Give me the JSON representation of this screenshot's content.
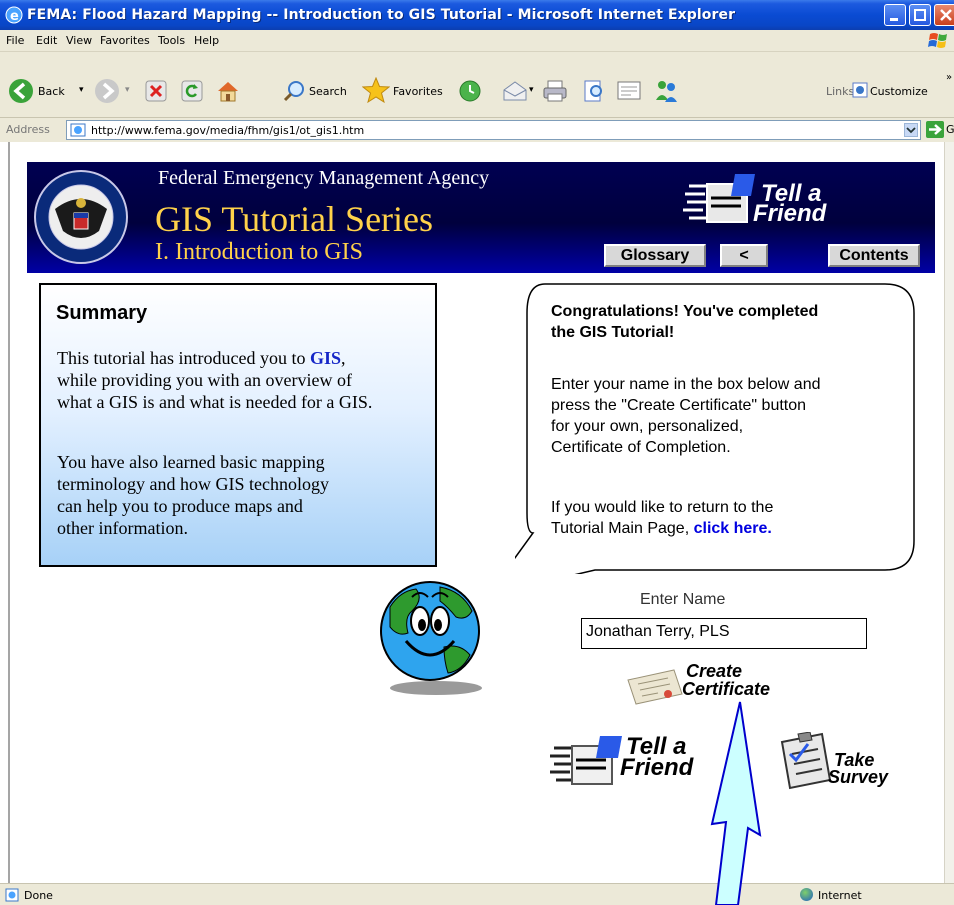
{
  "window": {
    "title": "FEMA: Flood Hazard Mapping -- Introduction to GIS Tutorial - Microsoft Internet Explorer"
  },
  "menubar": {
    "items": [
      "File",
      "Edit",
      "View",
      "Favorites",
      "Tools",
      "Help"
    ]
  },
  "toolbar": {
    "back_label": "Back",
    "search_label": "Search",
    "favorites_label": "Favorites",
    "links_label": "Links",
    "customize_label": "Customize"
  },
  "address": {
    "label": "Address",
    "url": "http://www.fema.gov/media/fhm/gis1/ot_gis1.htm",
    "go_label": "Go"
  },
  "banner": {
    "agency": "Federal Emergency Management Agency",
    "series": "GIS Tutorial Series",
    "chapter": "I. Introduction to GIS",
    "tell_a_friend_line1": "Tell a",
    "tell_a_friend_line2": "Friend",
    "glossary_label": "Glossary",
    "back_label": "<",
    "contents_label": "Contents"
  },
  "summary": {
    "heading": "Summary",
    "para1_pre": "This tutorial has introduced you to ",
    "para1_link": "GIS",
    "para1_post": ",",
    "para1_line2": "while providing you with an overview of",
    "para1_line3": "what a GIS is and what is needed for a GIS.",
    "para2_line1": "You have also learned basic mapping",
    "para2_line2": "terminology and how GIS technology",
    "para2_line3": "can help you to produce maps and",
    "para2_line4": "other information."
  },
  "bubble": {
    "congrats_line1": "Congratulations! You've completed",
    "congrats_line2": "the GIS Tutorial!",
    "instr_line1": "Enter your name in the box below and",
    "instr_line2": "press the \"Create Certificate\" button",
    "instr_line3": "for your own, personalized,",
    "instr_line4": "Certificate of Completion.",
    "return_line1": "If you would like to return to the",
    "return_line2": "Tutorial Main Page, ",
    "return_link": "click here."
  },
  "certificate": {
    "enter_name_label": "Enter Name",
    "name_value": "Jonathan Terry, PLS",
    "create_line1": "Create",
    "create_line2": "Certificate"
  },
  "footer_links": {
    "tell_line1": "Tell a",
    "tell_line2": "Friend",
    "survey_line1": "Take",
    "survey_line2": "Survey"
  },
  "statusbar": {
    "status": "Done",
    "zone": "Internet"
  },
  "colors": {
    "banner_bg": "#000052",
    "banner_gold": "#ffd24a",
    "link_blue": "#0000e0",
    "summary_gradient_end": "#a7d1f7",
    "arrow_fill": "#ccffff",
    "arrow_stroke": "#0000cc"
  }
}
